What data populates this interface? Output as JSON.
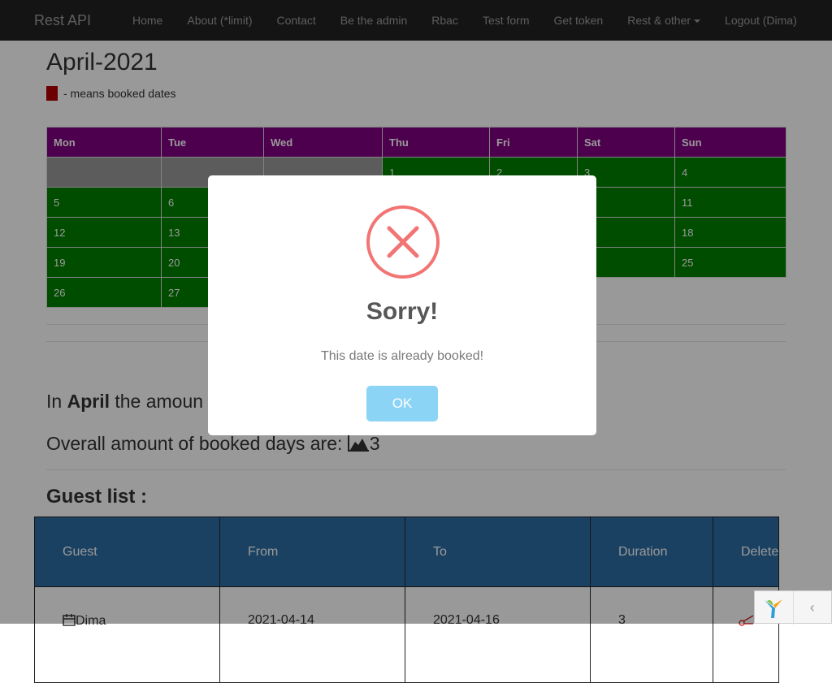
{
  "navbar": {
    "brand": "Rest API",
    "items": [
      "Home",
      "About (*limit)",
      "Contact",
      "Be the admin",
      "Rbac",
      "Test form",
      "Get token",
      "Rest & other",
      "Logout (Dima)"
    ]
  },
  "page": {
    "month_title": "April-2021",
    "legend_text": "- means booked dates",
    "legend_color": "#b30000",
    "stat_prefix": "In",
    "stat_month": "April",
    "stat_suffix": "the amoun",
    "overall_label": "Overall amount of booked days are:",
    "overall_value": "3",
    "guest_title": "Guest list :"
  },
  "calendar": {
    "headers": [
      "Mon",
      "Tue",
      "Wed",
      "Thu",
      "Fri",
      "Sat",
      "Sun"
    ],
    "header_color": "#800080",
    "day_color": "#008000",
    "weeks": [
      [
        "",
        "",
        "",
        "1",
        "2",
        "3",
        "4"
      ],
      [
        "5",
        "6",
        "",
        "",
        "",
        "",
        "11"
      ],
      [
        "12",
        "13",
        "",
        "",
        "",
        "",
        "18"
      ],
      [
        "19",
        "20",
        "",
        "",
        "",
        "",
        "25"
      ],
      [
        "26",
        "27",
        "",
        "",
        "",
        "",
        ""
      ]
    ]
  },
  "guests": {
    "headers": [
      "Guest",
      "From",
      "To",
      "Duration",
      "Delete"
    ],
    "rows": [
      [
        "Dima",
        "2021-04-14",
        "2021-04-16",
        "3",
        ""
      ]
    ]
  },
  "modal": {
    "title": "Sorry!",
    "text": "This date is already booked!",
    "ok_label": "OK",
    "icon": "error-x-icon"
  }
}
